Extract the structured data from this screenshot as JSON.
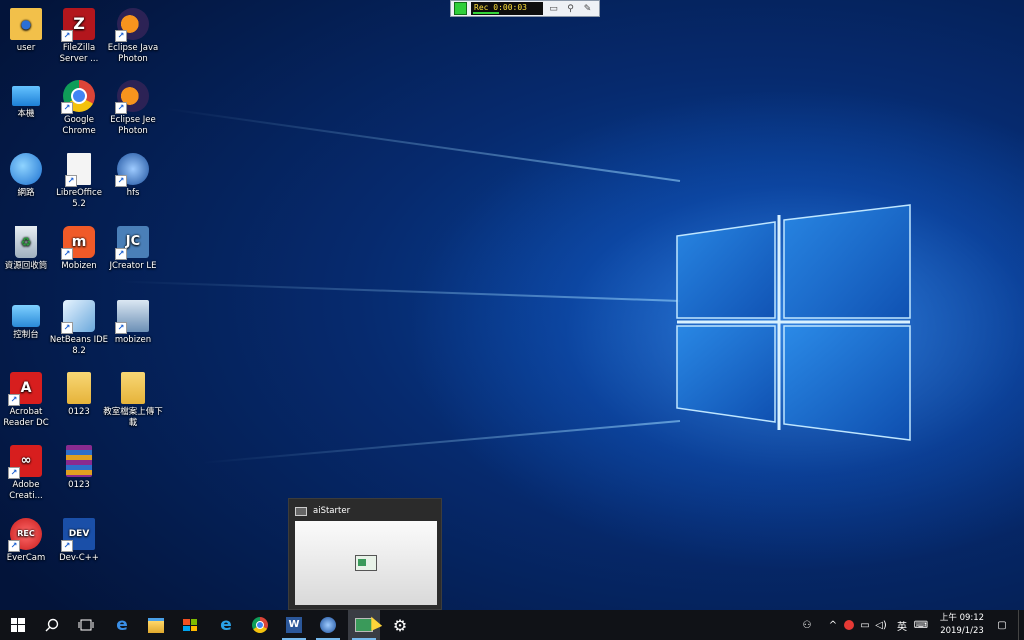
{
  "recorder": {
    "time": "Rec 0:00:03"
  },
  "desktop_icons": [
    {
      "label": "user"
    },
    {
      "label": "FileZilla Server ..."
    },
    {
      "label": "Eclipse Java Photon"
    },
    {
      "label": "本機"
    },
    {
      "label": "Google Chrome"
    },
    {
      "label": "Eclipse Jee Photon"
    },
    {
      "label": "網路"
    },
    {
      "label": "LibreOffice 5.2"
    },
    {
      "label": "hfs"
    },
    {
      "label": "資源回收筒"
    },
    {
      "label": "Mobizen"
    },
    {
      "label": "JCreator LE"
    },
    {
      "label": "控制台"
    },
    {
      "label": "NetBeans IDE 8.2"
    },
    {
      "label": "mobizen"
    },
    {
      "label": "Acrobat Reader DC"
    },
    {
      "label": "0123"
    },
    {
      "label": "教室檔案上傳下載"
    },
    {
      "label": "Adobe Creati..."
    },
    {
      "label": "0123"
    },
    {
      "label": "EverCam"
    },
    {
      "label": "Dev-C++"
    }
  ],
  "taskbar_preview": {
    "title": "aiStarter"
  },
  "taskbar_apps": [
    {
      "icon": "start-icon"
    },
    {
      "icon": "search-icon"
    },
    {
      "icon": "task-view-icon"
    },
    {
      "icon": "edge-icon"
    },
    {
      "icon": "file-explorer-icon"
    },
    {
      "icon": "store-icon"
    },
    {
      "icon": "ie-icon"
    },
    {
      "icon": "chrome-icon"
    },
    {
      "icon": "word-icon"
    },
    {
      "icon": "hfs-icon"
    },
    {
      "icon": "aistarter-icon"
    },
    {
      "icon": "settings-icon"
    }
  ],
  "tray": {
    "ime": "英",
    "clock_time": "上午 09:12",
    "clock_date": "2019/1/23"
  },
  "colors": {
    "taskbar": "#101217",
    "running_indicator": "#76b9ed",
    "rec_text": "#ffe23a"
  }
}
